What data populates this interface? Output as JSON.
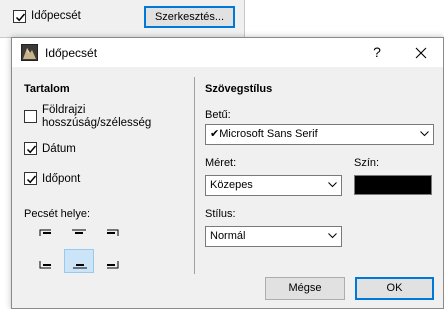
{
  "background": {
    "checkbox_label": "Időpecsét",
    "checkbox_checked": true,
    "edit_button_label": "Szerkesztés..."
  },
  "dialog": {
    "title": "Időpecsét",
    "help_label": "?",
    "close_label": "✕",
    "content": {
      "title": "Tartalom",
      "items": [
        {
          "label": "Földrajzi hosszúság/szélesség",
          "checked": false
        },
        {
          "label": "Dátum",
          "checked": true
        },
        {
          "label": "Időpont",
          "checked": true
        }
      ]
    },
    "position": {
      "title": "Pecsét helye:",
      "options": [
        "top-left",
        "top-center",
        "top-right",
        "bottom-left",
        "bottom-center",
        "bottom-right"
      ],
      "selected": "bottom-center"
    },
    "style": {
      "title": "Szövegstílus",
      "font_label": "Betű:",
      "font_value": "✔Microsoft Sans Serif",
      "size_label": "Méret:",
      "size_value": "Közepes",
      "color_label": "Szín:",
      "color_value": "#000000",
      "style_label": "Stílus:",
      "style_value": "Normál"
    },
    "buttons": {
      "cancel_label": "Mégse",
      "ok_label": "OK"
    }
  },
  "colors": {
    "accent": "#0078d7",
    "selected_bg": "#cce4f7",
    "dialog_bg": "#f0f0f0"
  }
}
